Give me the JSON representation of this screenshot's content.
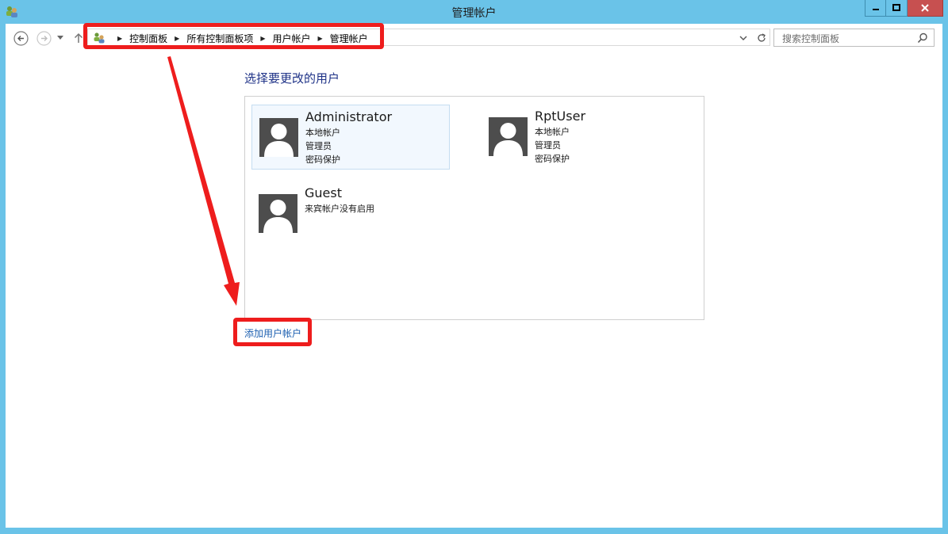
{
  "window": {
    "title": "管理帐户"
  },
  "nav": {
    "crumbs": [
      "控制面板",
      "所有控制面板项",
      "用户帐户",
      "管理帐户"
    ]
  },
  "search": {
    "placeholder": "搜索控制面板"
  },
  "content": {
    "heading": "选择要更改的用户",
    "users": [
      {
        "name": "Administrator",
        "lines": [
          "本地帐户",
          "管理员",
          "密码保护"
        ],
        "selected": true
      },
      {
        "name": "RptUser",
        "lines": [
          "本地帐户",
          "管理员",
          "密码保护"
        ],
        "selected": false
      },
      {
        "name": "Guest",
        "lines": [
          "来宾帐户没有启用"
        ],
        "selected": false
      }
    ],
    "add_user_link": "添加用户帐户"
  },
  "colors": {
    "titlebar": "#6ac3e8",
    "close_button": "#c75050",
    "annotation_red": "#ee1d1d",
    "heading_blue": "#1e3287",
    "link_blue": "#1c5fb0"
  },
  "icons": {
    "back": "back-arrow-icon",
    "forward": "forward-arrow-icon",
    "up": "up-arrow-icon",
    "refresh": "refresh-icon",
    "search": "search-icon"
  }
}
